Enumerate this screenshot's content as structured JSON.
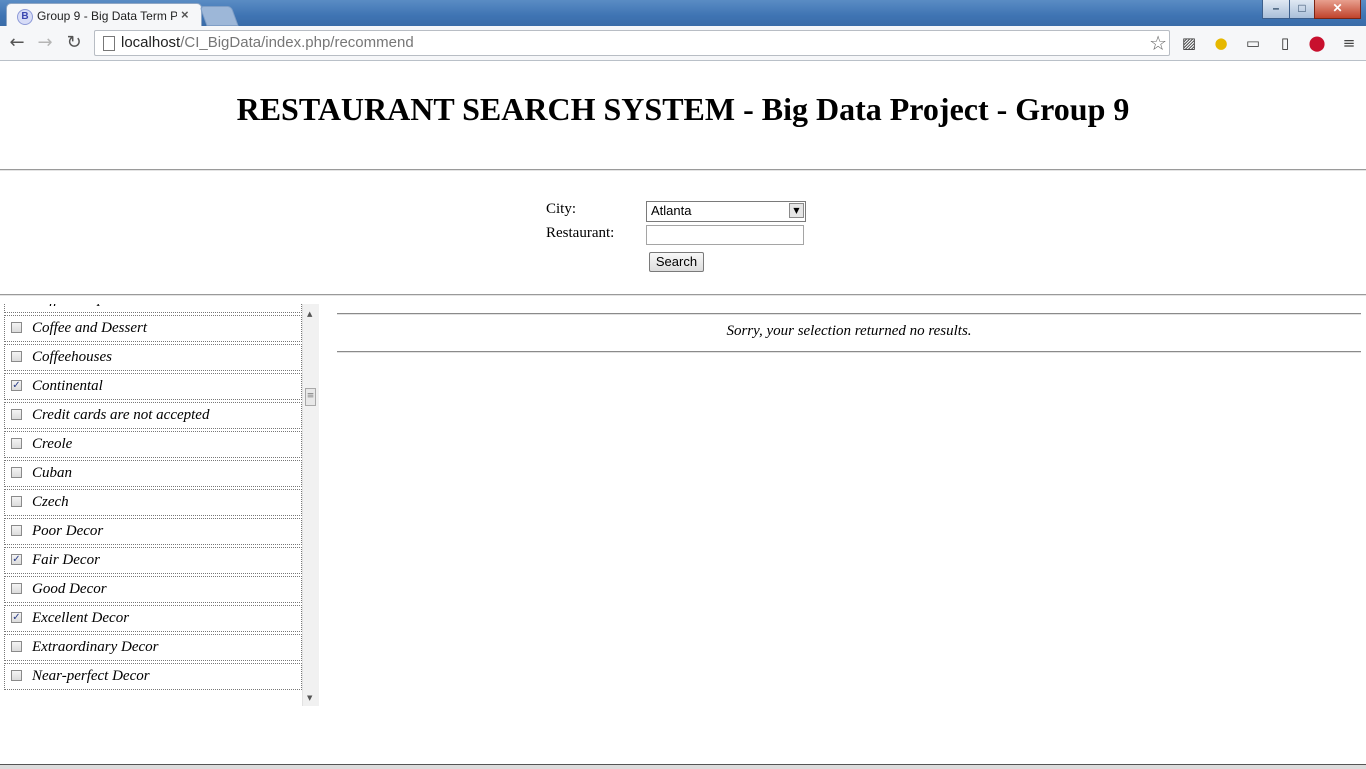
{
  "browser": {
    "tab_title": "Group 9 - Big Data Term P",
    "tab_favicon_letter": "B",
    "tab_close": "×",
    "url_host": "localhost",
    "url_path": "/CI_BigData/index.php/recommend",
    "window_buttons": {
      "minimize": "–",
      "maximize": "□",
      "close": "✕"
    }
  },
  "page": {
    "title": "RESTAURANT SEARCH SYSTEM - Big Data Project - Group 9",
    "form": {
      "city_label": "City:",
      "city_value": "Atlanta",
      "restaurant_label": "Restaurant:",
      "restaurant_value": "",
      "search_button": "Search"
    },
    "filters": [
      {
        "label": "Coffee Shops",
        "checked": false
      },
      {
        "label": "Coffee and Dessert",
        "checked": false
      },
      {
        "label": "Coffeehouses",
        "checked": false
      },
      {
        "label": "Continental",
        "checked": true
      },
      {
        "label": "Credit cards are not accepted",
        "checked": false
      },
      {
        "label": "Creole",
        "checked": false
      },
      {
        "label": "Cuban",
        "checked": false
      },
      {
        "label": "Czech",
        "checked": false
      },
      {
        "label": "Poor Decor",
        "checked": false
      },
      {
        "label": "Fair Decor",
        "checked": true
      },
      {
        "label": "Good Decor",
        "checked": false
      },
      {
        "label": "Excellent Decor",
        "checked": true
      },
      {
        "label": "Extraordinary Decor",
        "checked": false
      },
      {
        "label": "Near-perfect Decor",
        "checked": false
      }
    ],
    "results_message": "Sorry, your selection returned no results."
  },
  "icons": {
    "back": "back-arrow-icon",
    "forward": "forward-arrow-icon",
    "reload": "reload-icon",
    "bookmark": "star-icon",
    "menu": "hamburger-menu-icon"
  }
}
